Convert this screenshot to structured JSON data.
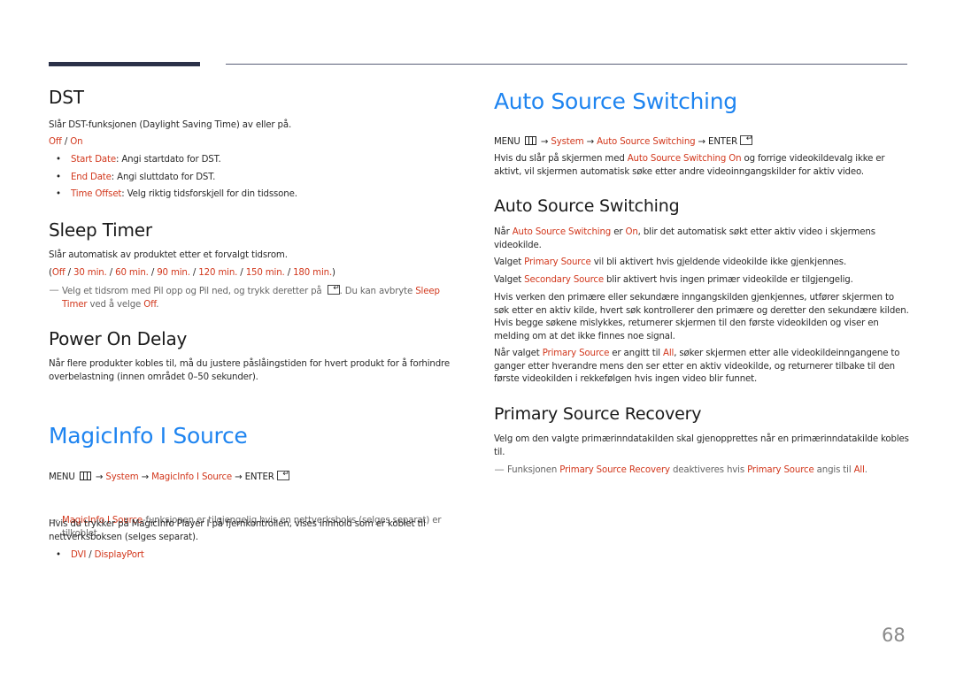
{
  "page": {
    "number": "68"
  },
  "dst": {
    "title": "DST",
    "desc": "Slår DST-funksjonen (Daylight Saving Time) av eller på.",
    "options": {
      "off": "Off",
      "sep": " / ",
      "on": "On"
    },
    "bullets": [
      {
        "term": "Start Date",
        "text": ": Angi startdato for DST."
      },
      {
        "term": "End Date",
        "text": ": Angi sluttdato for DST."
      },
      {
        "term": "Time Offset",
        "text": ": Velg riktig tidsforskjell for din tidssone."
      }
    ]
  },
  "sleep_timer": {
    "title": "Sleep Timer",
    "desc": "Slår automatisk av produktet etter et forvalgt tidsrom.",
    "options": [
      "Off",
      "30 min.",
      "60 min.",
      "90 min.",
      "120 min.",
      "150 min.",
      "180 min."
    ],
    "paren_open": "(",
    "paren_close": ")",
    "sep": " / ",
    "note": {
      "dash": "―",
      "text1": "Velg et tidsrom med Pil opp og Pil ned, og trykk deretter på ",
      "text2": ". Du kan avbryte ",
      "term1": "Sleep Timer",
      "text3": " ved å velge ",
      "term2": "Off",
      "text4": "."
    }
  },
  "power_on_delay": {
    "title": "Power On Delay",
    "desc": "Når flere produkter kobles til, må du justere påslåingstiden for hvert produkt for å forhindre overbelastning (innen området 0–50 sekunder)."
  },
  "magicinfo": {
    "title": "MagicInfo I Source",
    "path": {
      "menu": "MENU",
      "arrow": " → ",
      "system": "System",
      "item": "MagicInfo I Source",
      "enter": "ENTER"
    },
    "note": {
      "dash": "―",
      "term": "MagicInfo I Source",
      "text": "-funksjonen er tilgjengelig hvis en nettverksboks (selges separat) er tilkoblet."
    },
    "desc": {
      "text1": "Hvis du trykker på ",
      "bold": "MagicInfo Player I",
      "text2": " på fjernkontrollen, vises innhold som er koblet til nettverksboksen (selges separat)."
    },
    "bullet": {
      "opt1": "DVI",
      "sep": " / ",
      "opt2": "DisplayPort"
    }
  },
  "auto_source": {
    "title": "Auto Source Switching",
    "path": {
      "menu": "MENU",
      "arrow": " → ",
      "system": "System",
      "item": "Auto Source Switching",
      "enter": "ENTER"
    },
    "intro": {
      "text1": "Hvis du slår på skjermen med ",
      "term": "Auto Source Switching On",
      "text2": " og forrige videokildevalg ikke er aktivt, vil skjermen automatisk søke etter andre videoinngangskilder for aktiv video."
    },
    "sub": {
      "title": "Auto Source Switching",
      "p1": {
        "text1": "Når ",
        "term1": "Auto Source Switching",
        "text2": " er ",
        "term2": "On",
        "text3": ", blir det automatisk søkt etter aktiv video i skjermens videokilde."
      },
      "p2": {
        "text1": "Valget ",
        "term": "Primary Source",
        "text2": " vil bli aktivert hvis gjeldende videokilde ikke gjenkjennes."
      },
      "p3": {
        "text1": "Valget ",
        "term": "Secondary Source",
        "text2": " blir aktivert hvis ingen primær videokilde er tilgjengelig."
      },
      "p4": "Hvis verken den primære eller sekundære inngangskilden gjenkjennes, utfører skjermen to søk etter en aktiv kilde, hvert søk kontrollerer den primære og deretter den sekundære kilden. Hvis begge søkene mislykkes, returnerer skjermen til den første videokilden og viser en melding om at det ikke finnes noe signal.",
      "p5": {
        "text1": "Når valget ",
        "term1": "Primary Source",
        "text2": " er angitt til ",
        "term2": "All",
        "text3": ", søker skjermen etter alle videokildeinngangene to ganger etter hverandre mens den ser etter en aktiv videokilde, og returnerer tilbake til den første videokilden i rekkefølgen hvis ingen video blir funnet."
      }
    }
  },
  "primary_recovery": {
    "title": "Primary Source Recovery",
    "desc": "Velg om den valgte primærinndatakilden skal gjenopprettes når en primærinndatakilde kobles til.",
    "note": {
      "dash": "―",
      "text1": "Funksjonen ",
      "term1": "Primary Source Recovery",
      "text2": " deaktiveres hvis ",
      "term2": "Primary Source",
      "text3": " angis til ",
      "term3": "All",
      "text4": "."
    }
  }
}
